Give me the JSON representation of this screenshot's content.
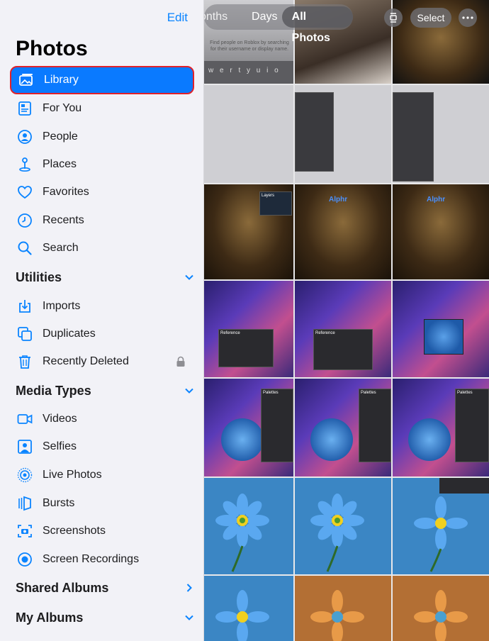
{
  "sidebar": {
    "edit_label": "Edit",
    "title": "Photos",
    "items": [
      {
        "label": "Library",
        "icon": "library-icon"
      },
      {
        "label": "For You",
        "icon": "for-you-icon"
      },
      {
        "label": "People",
        "icon": "people-icon"
      },
      {
        "label": "Places",
        "icon": "places-icon"
      },
      {
        "label": "Favorites",
        "icon": "heart-icon"
      },
      {
        "label": "Recents",
        "icon": "clock-icon"
      },
      {
        "label": "Search",
        "icon": "search-icon"
      }
    ],
    "utilities": {
      "title": "Utilities",
      "items": [
        {
          "label": "Imports",
          "icon": "import-icon"
        },
        {
          "label": "Duplicates",
          "icon": "duplicates-icon"
        },
        {
          "label": "Recently Deleted",
          "icon": "trash-icon"
        }
      ]
    },
    "media_types": {
      "title": "Media Types",
      "items": [
        {
          "label": "Videos",
          "icon": "video-icon"
        },
        {
          "label": "Selfies",
          "icon": "selfie-icon"
        },
        {
          "label": "Live Photos",
          "icon": "live-photo-icon"
        },
        {
          "label": "Bursts",
          "icon": "burst-icon"
        },
        {
          "label": "Screenshots",
          "icon": "screenshot-icon"
        },
        {
          "label": "Screen Recordings",
          "icon": "screen-recording-icon"
        }
      ]
    },
    "shared_albums": {
      "title": "Shared Albums"
    },
    "my_albums": {
      "title": "My Albums"
    },
    "accent_color": "#0a84ff",
    "selected_item": "Library"
  },
  "toolbar": {
    "segments": [
      "onths",
      "Days",
      "All Photos"
    ],
    "select_label": "Select"
  },
  "thumb_texts": {
    "search_hint": "Find people on Roblox by searching for their username or display name.",
    "keyboard_row": "w e r t y u i o",
    "alphr": "Alphr",
    "layers": "Layers",
    "reference": "Reference",
    "palettes": "Palettes"
  }
}
